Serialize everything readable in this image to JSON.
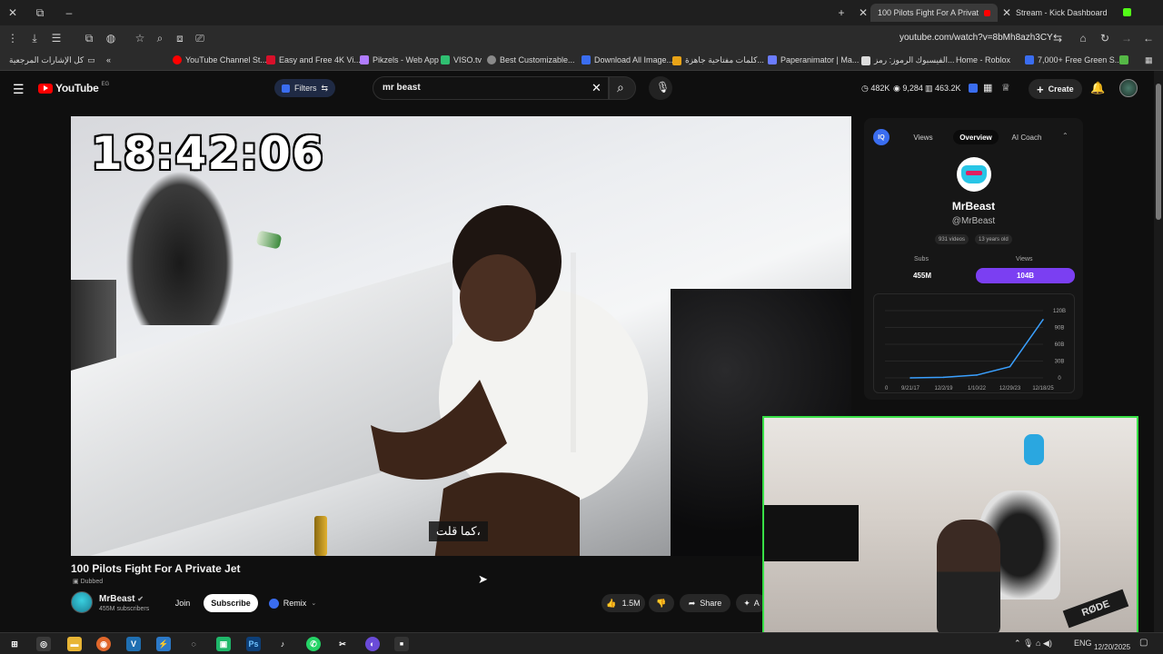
{
  "browser": {
    "tabs": [
      {
        "title": "100 Pilots Fight For A Privat",
        "active": true
      },
      {
        "title": "Stream - Kick Dashboard",
        "active": false
      }
    ],
    "url": "youtube.com/watch?v=8bMh8azh3CY",
    "bookmarks": [
      "كل الإشارات المرجعية",
      "YouTube Channel St...",
      "Easy and Free 4K Vi...",
      "Pikzels - Web App",
      "VISO.tv",
      "Best Customizable...",
      "Download All Image...",
      "كلمات مفتاحية جاهزة...",
      "Paperanimator | Ma...",
      "الفيسبوك الرموز: رمز...",
      "Home - Roblox",
      "7,000+ Free Green S..."
    ]
  },
  "youtube": {
    "logo": "YouTube",
    "region": "EG",
    "filters_label": "Filters",
    "search_value": "mr beast",
    "stats": [
      "482K",
      "9,284",
      "463.2K"
    ],
    "create_label": "Create",
    "video": {
      "timer": "18:42:06",
      "caption": "كما قلت،",
      "title": "100 Pilots Fight For A Private Jet",
      "dubbed": "Dubbed",
      "channel_name": "MrBeast",
      "subscribers": "455M subscribers",
      "join_label": "Join",
      "subscribe_label": "Subscribe",
      "remix_label": "Remix",
      "likes": "1.5M",
      "share_label": "Share",
      "ask_label": "A"
    }
  },
  "panel": {
    "tabs": [
      "Views",
      "Overview",
      "AI Coach"
    ],
    "active_tab": "Overview",
    "channel_name": "MrBeast",
    "handle": "@MrBeast",
    "chips": [
      "931 videos",
      "13 years old"
    ],
    "subs_label": "Subs",
    "subs_value": "455M",
    "views_label": "Views",
    "views_value": "104B",
    "chart_data": {
      "type": "line",
      "x": [
        "9/21/17",
        "12/2/19",
        "1/10/22",
        "12/29/23",
        "12/18/25"
      ],
      "x_first_label": "0",
      "y_ticks": [
        "0",
        "30B",
        "60B",
        "90B",
        "120B"
      ],
      "ylim": [
        0,
        120
      ],
      "series": [
        {
          "values": [
            0,
            1,
            5,
            20,
            104
          ]
        }
      ],
      "color": "#3aa0ff"
    }
  },
  "taskbar": {
    "lang": "ENG",
    "time": "",
    "date": "12/20/2025"
  },
  "colors": {
    "accent_purple": "#7b3ff2",
    "kick_green": "#38e046",
    "youtube_red": "#ff0000"
  }
}
